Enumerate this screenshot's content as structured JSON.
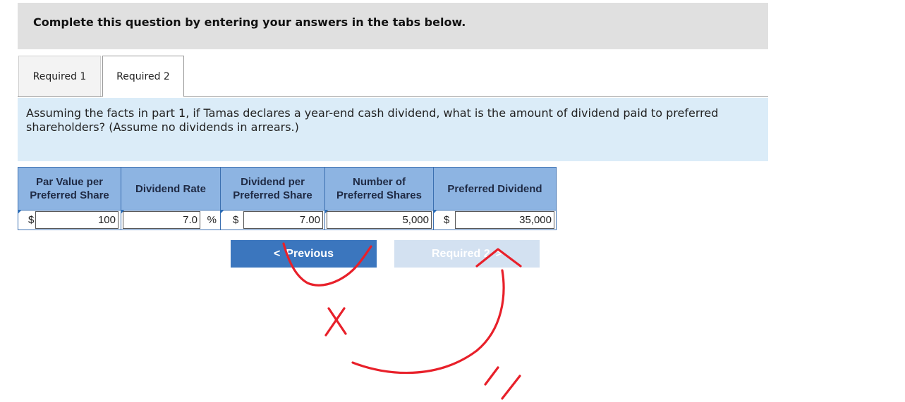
{
  "header": {
    "instruction": "Complete this question by entering your answers in the tabs below."
  },
  "tabs": [
    {
      "label": "Required 1"
    },
    {
      "label": "Required 2"
    }
  ],
  "question": {
    "text": "Assuming the facts in part 1, if Tamas declares a year-end cash dividend, what is the amount of dividend paid to preferred shareholders? (Assume no dividends in arrears.)"
  },
  "table": {
    "headers": {
      "par_value": [
        "Par Value per",
        "Preferred Share"
      ],
      "dividend_rate": "Dividend Rate",
      "dividend_per_share": [
        "Dividend per",
        "Preferred Share"
      ],
      "num_shares": [
        "Number of",
        "Preferred Shares"
      ],
      "preferred_dividend": "Preferred Dividend"
    },
    "row": {
      "par_value_currency": "$",
      "par_value": "100",
      "dividend_rate": "7.0",
      "rate_unit": "%",
      "dividend_per_share_currency": "$",
      "dividend_per_share": "7.00",
      "num_shares": "5,000",
      "preferred_dividend_currency": "$",
      "preferred_dividend": "35,000"
    }
  },
  "nav": {
    "previous_arrow": "<",
    "previous_label": "Previous",
    "next_label": "Required 2",
    "next_arrow": ">"
  },
  "colors": {
    "header_bg": "#e0e0e0",
    "question_bg": "#dbecf8",
    "table_header_bg": "#8db4e2",
    "primary_button": "#3b76be",
    "disabled_button": "#d3e1f1",
    "annotation": "#e8202a"
  }
}
